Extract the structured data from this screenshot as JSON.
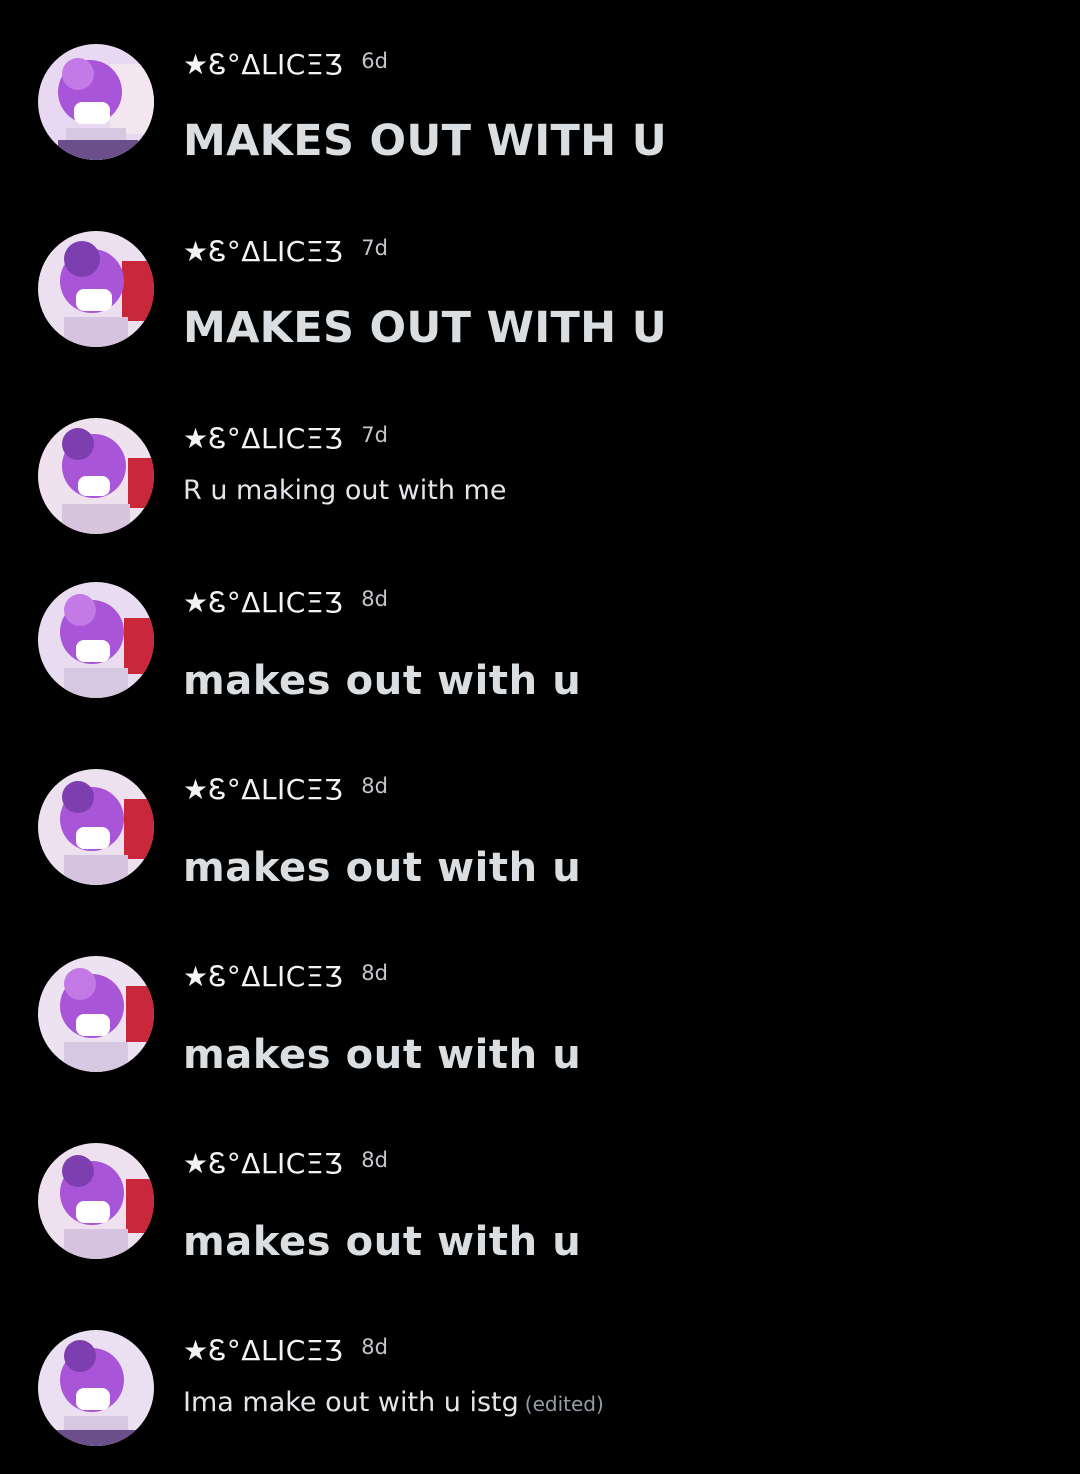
{
  "colors": {
    "background": "#000000",
    "text": "#dbdee1",
    "muted": "#949ba4",
    "avatar_hair": "#a855d8",
    "avatar_bg_red": "#c8283a"
  },
  "messages": [
    {
      "username": "★Ꮛ°ΔLICΞƷ",
      "timestamp": "6d",
      "content": "MAKES OUT WITH U",
      "style": "h1",
      "edited": ""
    },
    {
      "username": "★Ꮛ°ΔLICΞƷ",
      "timestamp": "7d",
      "content": "MAKES OUT WITH U",
      "style": "h1",
      "edited": ""
    },
    {
      "username": "★Ꮛ°ΔLICΞƷ",
      "timestamp": "7d",
      "content": "R u making out with me",
      "style": "plain",
      "edited": ""
    },
    {
      "username": "★Ꮛ°ΔLICΞƷ",
      "timestamp": "8d",
      "content": "makes out with u",
      "style": "h2",
      "edited": ""
    },
    {
      "username": "★Ꮛ°ΔLICΞƷ",
      "timestamp": "8d",
      "content": "makes out with u",
      "style": "h2",
      "edited": ""
    },
    {
      "username": "★Ꮛ°ΔLICΞƷ",
      "timestamp": "8d",
      "content": "makes out with u",
      "style": "h2",
      "edited": ""
    },
    {
      "username": "★Ꮛ°ΔLICΞƷ",
      "timestamp": "8d",
      "content": "makes out with u",
      "style": "h2",
      "edited": ""
    },
    {
      "username": "★Ꮛ°ΔLICΞƷ",
      "timestamp": "8d",
      "content": "Ima make out with u istg",
      "style": "plain",
      "edited": "(edited)"
    }
  ]
}
